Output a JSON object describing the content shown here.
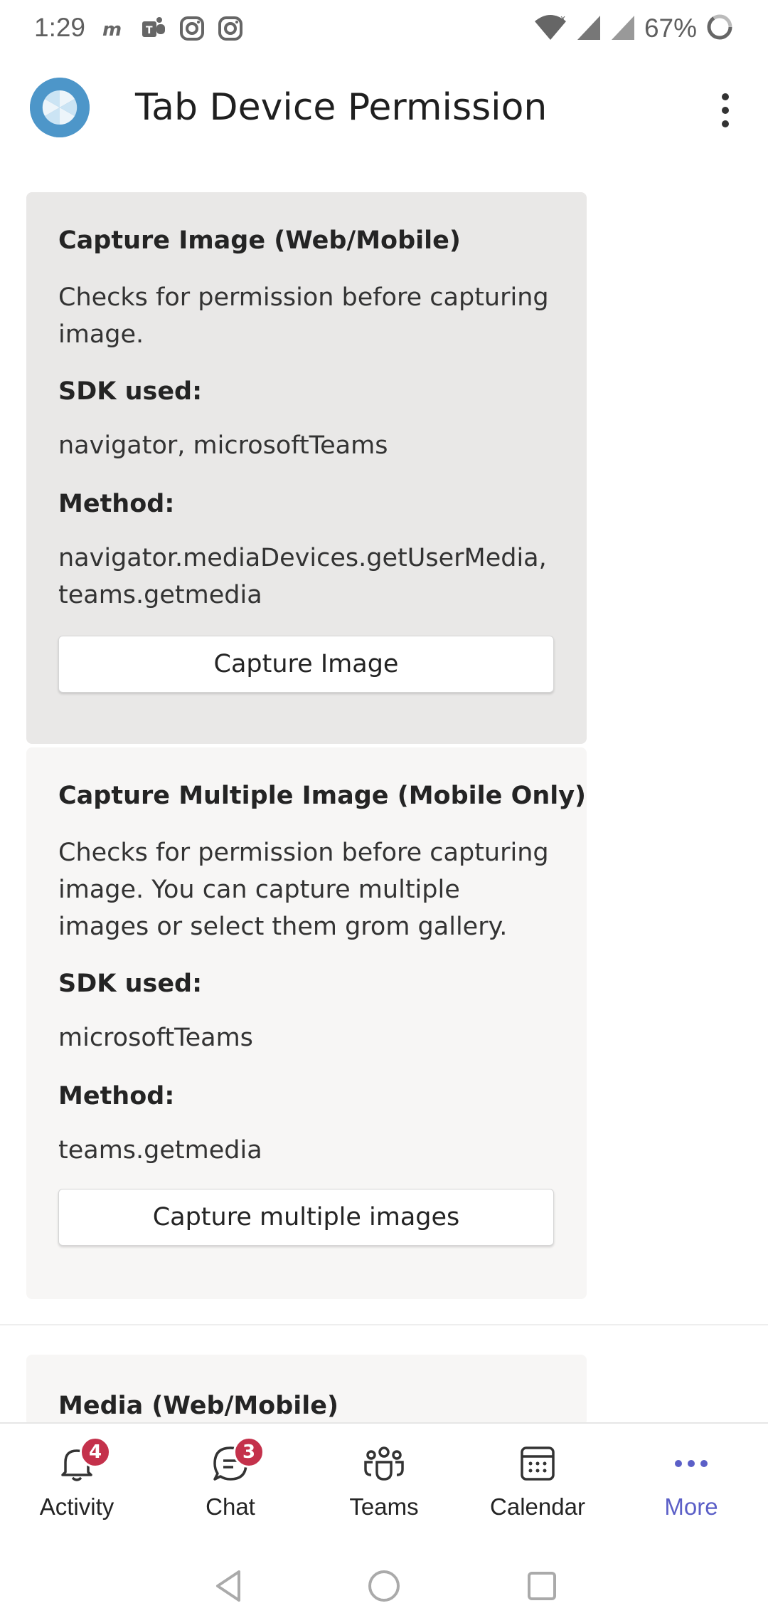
{
  "status_bar": {
    "time": "1:29",
    "battery": "67%",
    "icons_left": [
      "myfitnesspal-icon",
      "teams-icon",
      "instagram-icon",
      "instagram-icon"
    ],
    "icons_right": [
      "wifi-icon",
      "signal-icon",
      "signal-icon",
      "battery-icon"
    ]
  },
  "header": {
    "title": "Tab Device Permission",
    "more_icon": "kebab-icon"
  },
  "cards": [
    {
      "heading": "Capture Image (Web/Mobile)",
      "description": "Checks for permission before capturing image.",
      "sdk_label": "SDK used:",
      "sdk_value": "navigator, microsoftTeams",
      "method_label": "Method:",
      "method_value": "navigator.mediaDevices.getUserMedia, teams.getmedia",
      "button_label": "Capture Image"
    },
    {
      "heading": "Capture Multiple Image (Mobile Only)",
      "description": "Checks for permission before capturing image. You can capture multiple images or select them grom gallery.",
      "sdk_label": "SDK used:",
      "sdk_value": "microsoftTeams",
      "method_label": "Method:",
      "method_value": "teams.getmedia",
      "button_label": "Capture multiple images"
    },
    {
      "heading": "Media (Web/Mobile)"
    }
  ],
  "bottom_nav": {
    "items": [
      {
        "label": "Activity",
        "icon": "bell-icon",
        "badge": "4"
      },
      {
        "label": "Chat",
        "icon": "chat-icon",
        "badge": "3"
      },
      {
        "label": "Teams",
        "icon": "teams-icon"
      },
      {
        "label": "Calendar",
        "icon": "calendar-icon"
      },
      {
        "label": "More",
        "icon": "more-icon",
        "active": true
      }
    ]
  },
  "colors": {
    "accent": "#5b5fc7",
    "badge": "#c4314b",
    "card_active": "#e9e8e7",
    "card": "#f7f6f5"
  }
}
